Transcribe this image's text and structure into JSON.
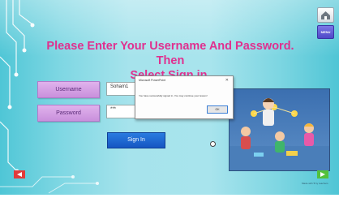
{
  "slide": {
    "title_line1": "Please Enter Your Username And Password. Then",
    "title_line2": "Select Sign in."
  },
  "form": {
    "username_label": "Username",
    "username_value": "Soham1",
    "password_label": "Password",
    "password_value": "***",
    "signin_label": "Sign In"
  },
  "dialog": {
    "title": "Microsoft PowerPoint",
    "message": "You have successfully signed in. You may continue your lesson!",
    "ok_label": "OK",
    "close_glyph": "✕"
  },
  "nav": {
    "menu_label": "MENU",
    "footer_text": "Made with ♥ by teachers"
  },
  "colors": {
    "title": "#e0308f",
    "label_bg": "#d9a6e8",
    "signin_bg": "#1f63d0",
    "nav_prev": "#e23b3b",
    "nav_next": "#53c13b"
  },
  "icons": [
    "home-icon",
    "menu-icon",
    "prev-arrow-icon",
    "next-arrow-icon",
    "circuit-decoration",
    "classroom-illustration"
  ]
}
